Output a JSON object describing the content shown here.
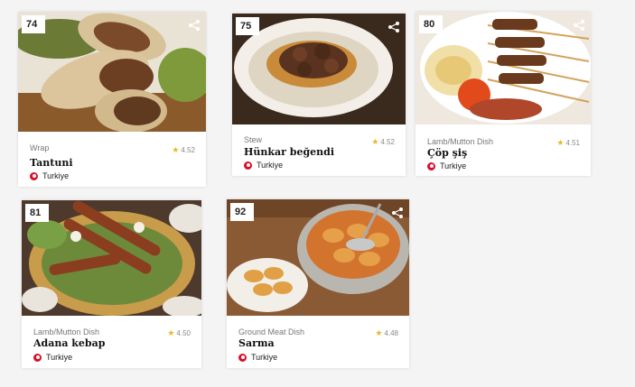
{
  "cards": [
    {
      "rank": "74",
      "category": "Wrap",
      "rating": "4.52",
      "name": "Tantuni",
      "country": "Turkiye",
      "photo": "tantuni wrap photo"
    },
    {
      "rank": "75",
      "category": "Stew",
      "rating": "4.52",
      "name": "Hünkar beğendi",
      "country": "Turkiye",
      "photo": "hunkar begendi photo"
    },
    {
      "rank": "80",
      "category": "Lamb/Mutton Dish",
      "rating": "4.51",
      "name": "Çöp şiş",
      "country": "Turkiye",
      "photo": "cop sis skewers photo"
    },
    {
      "rank": "81",
      "category": "Lamb/Mutton Dish",
      "rating": "4.50",
      "name": "Adana kebap",
      "country": "Turkiye",
      "photo": "adana kebap platter photo"
    },
    {
      "rank": "92",
      "category": "Ground Meat Dish",
      "rating": "4.48",
      "name": "Sarma",
      "country": "Turkiye",
      "photo": "sarma pot photo"
    }
  ],
  "icons": {
    "share": "share-icon",
    "star": "star-icon",
    "flag": "turkey-flag-icon"
  },
  "colors": {
    "star": "#e8b923",
    "flag": "#d8102a"
  }
}
